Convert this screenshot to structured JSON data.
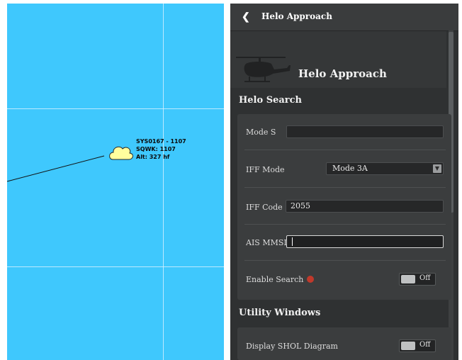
{
  "map": {
    "track": {
      "line1": "SYS0167 - 1107",
      "line2": "SQWK: 1107",
      "line3": "Alt: 327 hf"
    },
    "colors": {
      "sea": "#3fc8fd",
      "track_marker": "#ffff9e"
    }
  },
  "panel": {
    "header": {
      "back_icon": "back-chevron-icon",
      "title": "Helo Approach"
    },
    "banner": {
      "icon": "helicopter-icon",
      "title": "Helo Approach"
    },
    "helo_search": {
      "title": "Helo Search",
      "mode_s": {
        "label": "Mode S",
        "value": ""
      },
      "iff_mode": {
        "label": "IFF Mode",
        "value": "Mode 3A"
      },
      "iff_code": {
        "label": "IFF Code",
        "value": "2055"
      },
      "ais_mmsi": {
        "label": "AIS MMSI",
        "value": ""
      },
      "enable_search": {
        "label": "Enable Search",
        "status_color": "#c0392b",
        "toggle": "Off"
      }
    },
    "utility_windows": {
      "title": "Utility Windows",
      "shol": {
        "label": "Display SHOL Diagram",
        "toggle": "Off"
      }
    }
  }
}
